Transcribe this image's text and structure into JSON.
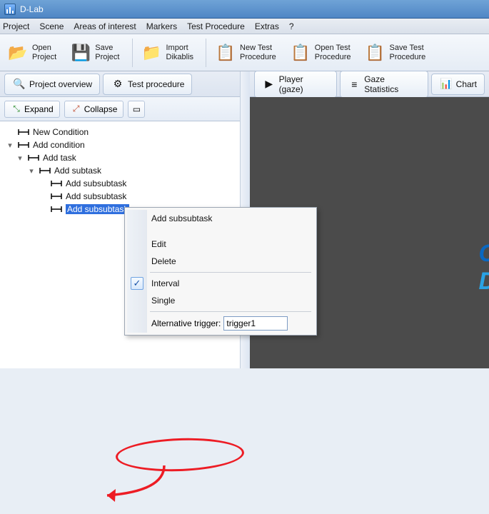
{
  "title": "D-Lab",
  "menu": [
    "Project",
    "Scene",
    "Areas of interest",
    "Markers",
    "Test Procedure",
    "Extras",
    "?"
  ],
  "toolbar": [
    {
      "id": "open-project",
      "label": "Open\nProject",
      "icon": "folder-open-icon",
      "cls": "fold"
    },
    {
      "id": "save-project",
      "label": "Save\nProject",
      "icon": "floppy-icon",
      "cls": "save"
    },
    {
      "sep": true
    },
    {
      "id": "import-dikablis",
      "label": "Import\nDikablis",
      "icon": "folder-import-icon",
      "cls": "imp"
    },
    {
      "sep": true
    },
    {
      "id": "new-test-procedure",
      "label": "New Test\nProcedure",
      "icon": "clipboard-new-icon",
      "cls": "np"
    },
    {
      "id": "open-test-procedure",
      "label": "Open Test\nProcedure",
      "icon": "clipboard-open-icon",
      "cls": "op"
    },
    {
      "id": "save-test-procedure",
      "label": "Save Test\nProcedure",
      "icon": "clipboard-save-icon",
      "cls": "sp"
    }
  ],
  "left_tabs": [
    {
      "id": "project-overview",
      "label": "Project overview",
      "icon": "magnifier-icon"
    },
    {
      "id": "test-procedure",
      "label": "Test procedure",
      "icon": "gear-doc-icon"
    }
  ],
  "right_tabs": [
    {
      "id": "player-gaze",
      "label": "Player (gaze)",
      "icon": "play-icon"
    },
    {
      "id": "gaze-statistics",
      "label": "Gaze Statistics",
      "icon": "stats-icon"
    },
    {
      "id": "chart",
      "label": "Chart",
      "icon": "chart-icon"
    }
  ],
  "tree_toolbar": {
    "expand": "Expand",
    "collapse": "Collapse"
  },
  "tree": {
    "items": [
      {
        "level": 1,
        "twisty": "",
        "label": "New Condition"
      },
      {
        "level": 1,
        "twisty": "▾",
        "label": "Add condition"
      },
      {
        "level": 2,
        "twisty": "▾",
        "label": "Add task"
      },
      {
        "level": 3,
        "twisty": "▾",
        "label": "Add subtask"
      },
      {
        "level": 4,
        "twisty": "",
        "label": "Add subsubtask"
      },
      {
        "level": 4,
        "twisty": "",
        "label": "Add subsubtask"
      },
      {
        "level": 4,
        "twisty": "",
        "label": "Add subsubtask",
        "selected": true
      }
    ]
  },
  "context_menu": {
    "items": [
      {
        "label": "Add subsubtask"
      },
      {
        "gap": true
      },
      {
        "label": "Edit"
      },
      {
        "label": "Delete"
      },
      {
        "sep": true
      },
      {
        "label": "Interval",
        "checked": true
      },
      {
        "label": "Single"
      },
      {
        "sep": true
      }
    ],
    "trigger_label": "Alternative trigger:",
    "trigger_value": "trigger1"
  },
  "brand": {
    "c": "C",
    "d": "D"
  }
}
